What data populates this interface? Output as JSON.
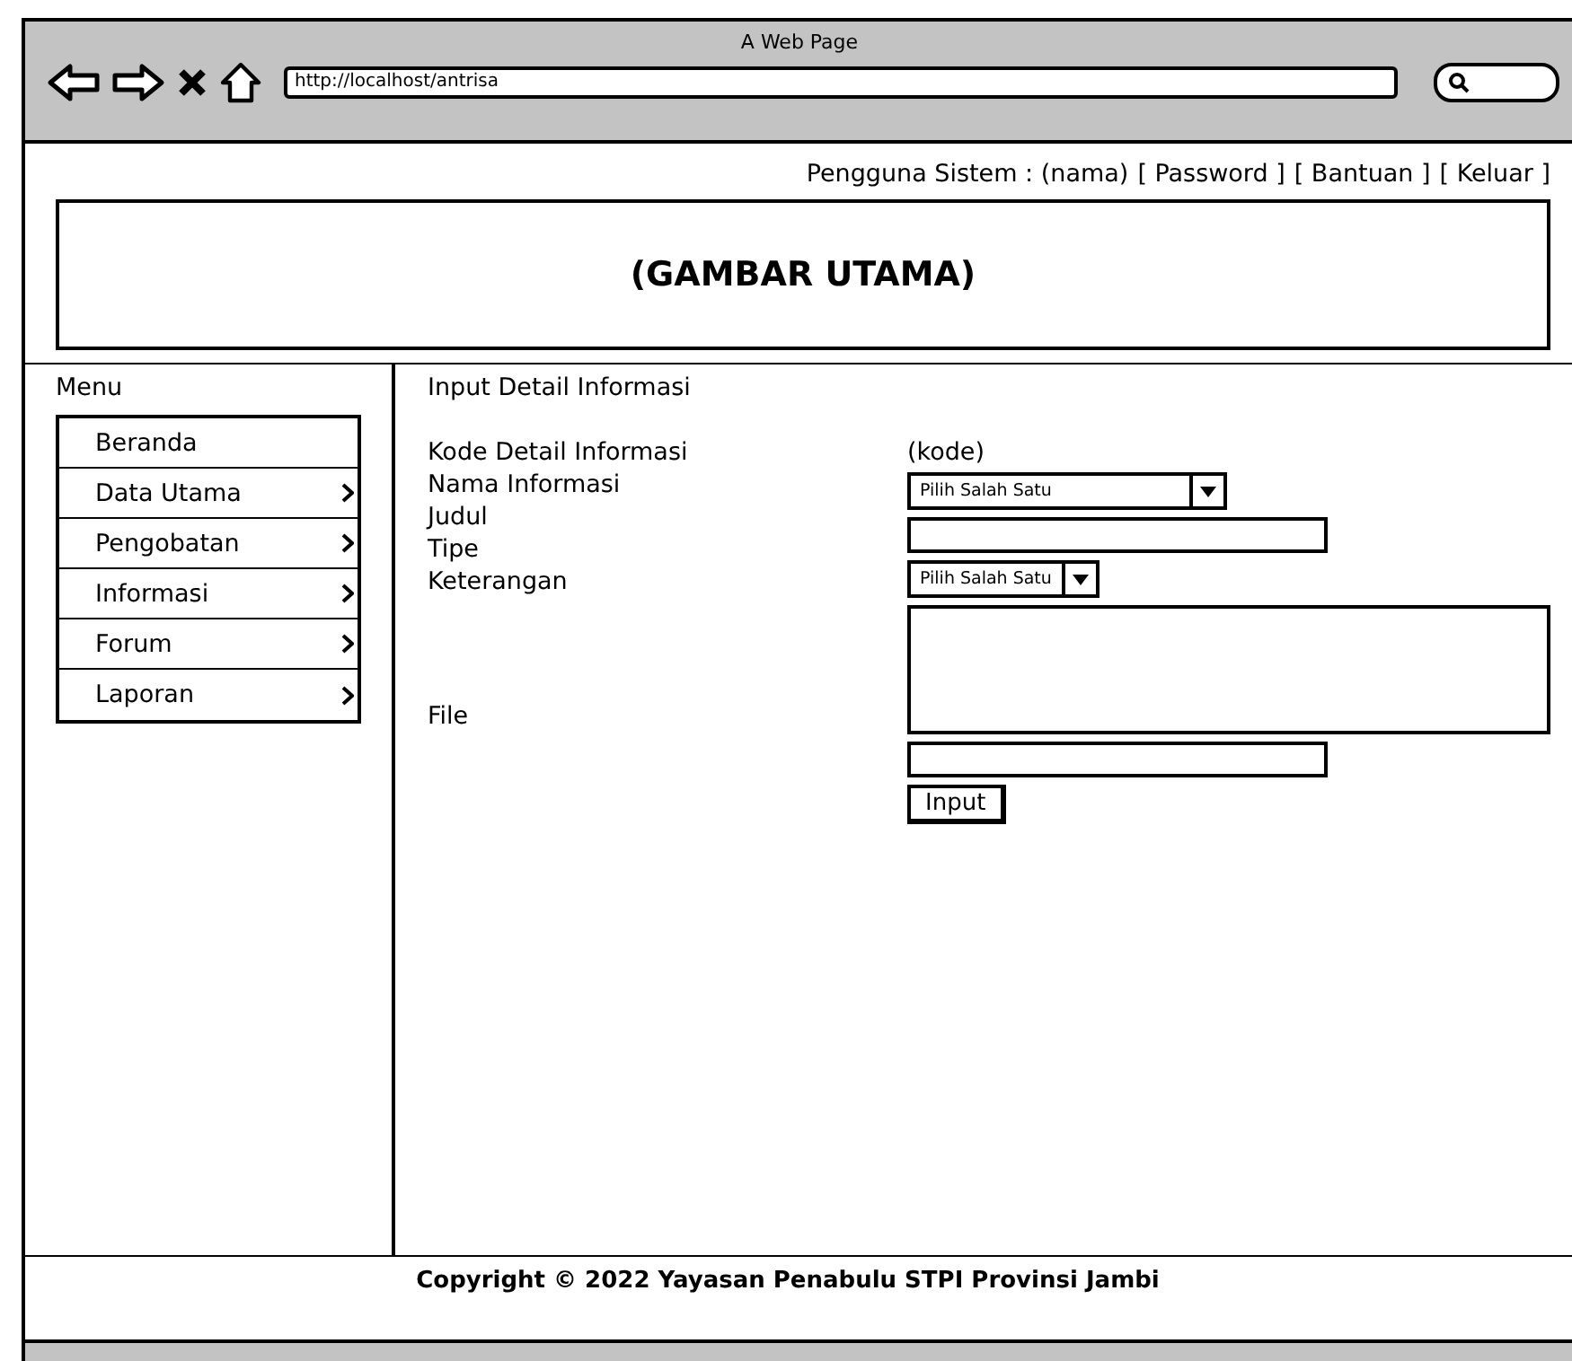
{
  "browser": {
    "title": "A Web Page",
    "url": "http://localhost/antrisa"
  },
  "user_bar": {
    "label": "Pengguna Sistem : (nama)",
    "links": [
      "[ Password ]",
      "[ Bantuan ]",
      "[ Keluar ]"
    ]
  },
  "banner": "(GAMBAR UTAMA)",
  "menu": {
    "title": "Menu",
    "items": [
      {
        "label": "Beranda",
        "has_submenu": false
      },
      {
        "label": "Data Utama",
        "has_submenu": true
      },
      {
        "label": "Pengobatan",
        "has_submenu": true
      },
      {
        "label": "Informasi",
        "has_submenu": true
      },
      {
        "label": "Forum",
        "has_submenu": true
      },
      {
        "label": "Laporan",
        "has_submenu": true
      }
    ]
  },
  "form": {
    "title": "Input Detail Informasi",
    "labels": [
      "Kode Detail Informasi",
      "Nama Informasi",
      "Judul",
      "Tipe",
      "Keterangan",
      "File"
    ],
    "fields": [
      {
        "kind": "value",
        "value": "(kode)"
      },
      {
        "kind": "select",
        "value": "Pilih Salah Satu"
      },
      {
        "kind": "input"
      },
      {
        "kind": "select",
        "value": "Pilih Salah Satu"
      },
      {
        "kind": "textarea"
      },
      {
        "kind": "input"
      }
    ],
    "button": "Input"
  },
  "footer": "Copyright © 2022 Yayasan Penabulu STPI Provinsi Jambi"
}
